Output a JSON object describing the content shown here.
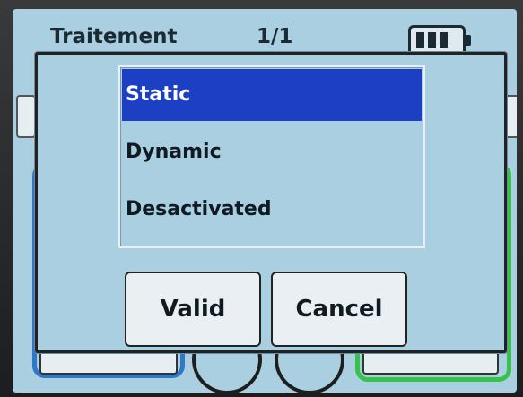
{
  "header": {
    "title": "Traitement",
    "page_indicator": "1/1",
    "battery_icon": "battery-icon"
  },
  "dialog": {
    "options": [
      {
        "label": "Static",
        "selected": true
      },
      {
        "label": "Dynamic",
        "selected": false
      },
      {
        "label": "Desactivated",
        "selected": false
      }
    ],
    "valid_label": "Valid",
    "cancel_label": "Cancel"
  },
  "colors": {
    "screen_background": "#a9cfe0",
    "selection": "#1d3fc4",
    "left_panel_border": "#2f78c8",
    "right_panel_border": "#37c24a"
  }
}
